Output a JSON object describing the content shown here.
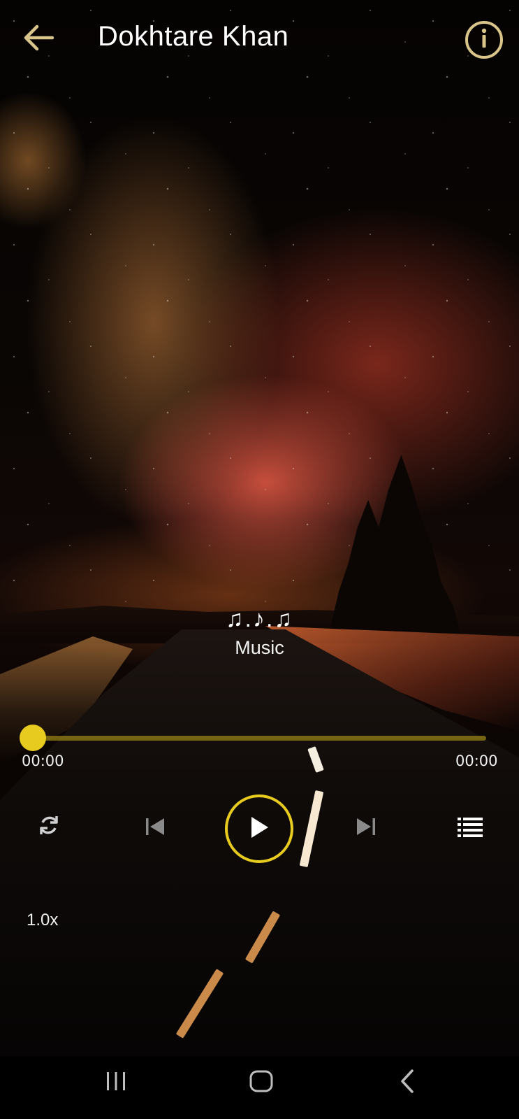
{
  "header": {
    "title": "Dokhtare Khan",
    "back_icon": "arrow-left-icon",
    "info_icon": "info-icon"
  },
  "track": {
    "artwork_text": "♫.♪.♫",
    "subtitle": "Music"
  },
  "player": {
    "elapsed": "00:00",
    "duration": "00:00",
    "progress": 0,
    "speed": "1.0x",
    "accent_color": "#e8cb1f",
    "controls": [
      "repeat-icon",
      "skip-previous-icon",
      "play-icon",
      "skip-next-icon",
      "playlist-icon"
    ]
  },
  "system_nav": [
    "recent-apps-icon",
    "home-icon",
    "back-icon"
  ]
}
